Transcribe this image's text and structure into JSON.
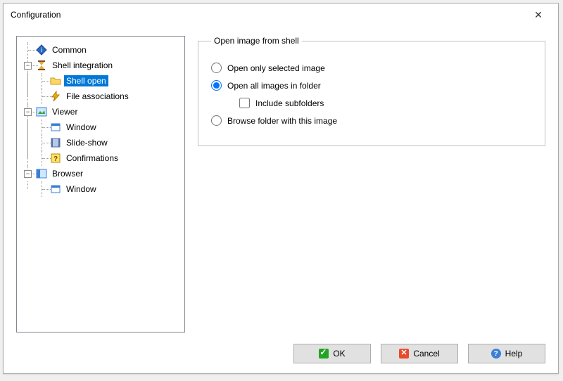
{
  "window": {
    "title": "Configuration"
  },
  "tree": {
    "common": "Common",
    "shell_integration": "Shell integration",
    "shell_open": "Shell open",
    "file_associations": "File associations",
    "viewer": "Viewer",
    "window": "Window",
    "slide_show": "Slide-show",
    "confirmations": "Confirmations",
    "browser": "Browser",
    "browser_window": "Window"
  },
  "group": {
    "legend": "Open image from shell",
    "opt_only_selected": "Open only selected image",
    "opt_all_in_folder": "Open all images in folder",
    "chk_include_subfolders": "Include subfolders",
    "opt_browse_with_image": "Browse folder with this image",
    "selected": "opt_all_in_folder",
    "include_subfolders_checked": false
  },
  "buttons": {
    "ok": "OK",
    "cancel": "Cancel",
    "help": "Help"
  }
}
